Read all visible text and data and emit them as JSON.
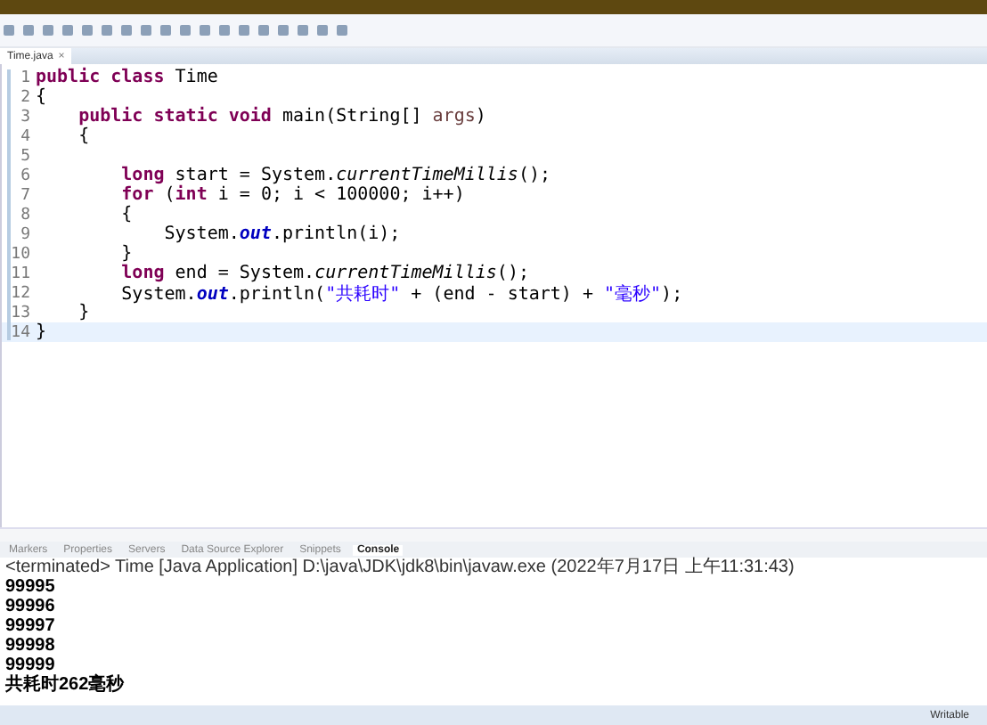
{
  "editor": {
    "tab": {
      "label": "Time.java",
      "close": "×",
      "selected": true
    },
    "lines": [
      {
        "number": "1",
        "current": false,
        "tokens": [
          {
            "kind": "keyword",
            "text": "public class "
          },
          {
            "kind": "plain",
            "text": "Time"
          }
        ]
      },
      {
        "number": "2",
        "current": false,
        "tokens": [
          {
            "kind": "plain",
            "text": "{"
          }
        ]
      },
      {
        "number": "3",
        "current": false,
        "tokens": [
          {
            "kind": "keyword",
            "text": "    public static void "
          },
          {
            "kind": "plain",
            "text": "main(String[] "
          },
          {
            "kind": "param",
            "text": "args"
          },
          {
            "kind": "plain",
            "text": ")"
          }
        ]
      },
      {
        "number": "4",
        "current": false,
        "tokens": [
          {
            "kind": "plain",
            "text": "    {"
          }
        ]
      },
      {
        "number": "5",
        "current": false
      },
      {
        "number": "6",
        "current": false,
        "tokens": [
          {
            "kind": "keyword",
            "text": "        long "
          },
          {
            "kind": "plain",
            "text": "start = System."
          },
          {
            "kind": "method",
            "text": "currentTimeMillis"
          },
          {
            "kind": "plain",
            "text": "();"
          }
        ]
      },
      {
        "number": "7",
        "current": false,
        "tokens": [
          {
            "kind": "keyword",
            "text": "        for "
          },
          {
            "kind": "plain",
            "text": "("
          },
          {
            "kind": "keyword",
            "text": "int "
          },
          {
            "kind": "plain",
            "text": "i = 0; i < 100000; i++)"
          }
        ]
      },
      {
        "number": "8",
        "current": false,
        "tokens": [
          {
            "kind": "plain",
            "text": "        {"
          }
        ]
      },
      {
        "number": "9",
        "current": false,
        "tokens": [
          {
            "kind": "plain",
            "text": "            System."
          },
          {
            "kind": "field",
            "text": "out"
          },
          {
            "kind": "plain",
            "text": ".println(i);"
          }
        ]
      },
      {
        "number": "10",
        "current": false,
        "tokens": [
          {
            "kind": "plain",
            "text": "        }"
          }
        ]
      },
      {
        "number": "11",
        "current": false,
        "tokens": [
          {
            "kind": "keyword",
            "text": "        long "
          },
          {
            "kind": "plain",
            "text": "end = System."
          },
          {
            "kind": "method",
            "text": "currentTimeMillis"
          },
          {
            "kind": "plain",
            "text": "();"
          }
        ]
      },
      {
        "number": "12",
        "current": false,
        "tokens": [
          {
            "kind": "plain",
            "text": "        System."
          },
          {
            "kind": "field",
            "text": "out"
          },
          {
            "kind": "plain",
            "text": ".println("
          },
          {
            "kind": "string",
            "text": "\"共耗时\""
          },
          {
            "kind": "plain",
            "text": " + (end - start) + "
          },
          {
            "kind": "string",
            "text": "\"毫秒\""
          },
          {
            "kind": "plain",
            "text": ");"
          }
        ]
      },
      {
        "number": "13",
        "current": false,
        "tokens": [
          {
            "kind": "plain",
            "text": "    }"
          }
        ]
      },
      {
        "number": "14",
        "current": true,
        "tokens": [
          {
            "kind": "plain",
            "text": "}"
          }
        ]
      }
    ]
  },
  "bottom_panel": {
    "tabs": [
      {
        "label": "Markers",
        "selected": false
      },
      {
        "label": "Properties",
        "selected": false
      },
      {
        "label": "Servers",
        "selected": false
      },
      {
        "label": "Data Source Explorer",
        "selected": false
      },
      {
        "label": "Snippets",
        "selected": false
      },
      {
        "label": "Console",
        "selected": true
      }
    ],
    "console_header": "<terminated> Time [Java Application] D:\\java\\JDK\\jdk8\\bin\\javaw.exe (2022年7月17日 上午11:31:43)",
    "output": [
      "99995",
      "99996",
      "99997",
      "99998",
      "99999",
      "共耗时262毫秒"
    ]
  },
  "status_bar": {
    "mode": "Writable"
  }
}
